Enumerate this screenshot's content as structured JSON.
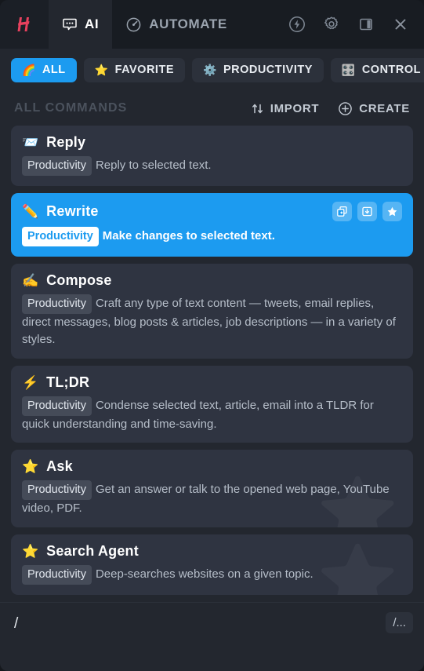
{
  "theme": {
    "page_bg": "#23272f",
    "chrome_bg": "#181c22",
    "card_bg": "#2f3441",
    "accent": "#1c9bf0",
    "logo_color": "#e8415e",
    "text_primary": "#ffffff",
    "text_muted": "#b6bec9",
    "section_title_color": "#4b525d"
  },
  "titlebar": {
    "logo_name": "app-logo",
    "tabs": [
      {
        "id": "ai",
        "label": "AI",
        "icon": "chat-bubble-icon",
        "active": true
      },
      {
        "id": "automate",
        "label": "AUTOMATE",
        "icon": "gauge-icon",
        "active": false
      }
    ],
    "icons": [
      {
        "id": "bolt",
        "name": "bolt-circle-icon"
      },
      {
        "id": "settings",
        "name": "gear-icon"
      },
      {
        "id": "panel",
        "name": "side-panel-icon"
      },
      {
        "id": "close",
        "name": "close-icon"
      }
    ]
  },
  "filters": [
    {
      "id": "all",
      "label": "ALL",
      "emoji": "🌈",
      "active": true
    },
    {
      "id": "favorite",
      "label": "FAVORITE",
      "emoji": "⭐",
      "active": false
    },
    {
      "id": "productivity",
      "label": "PRODUCTIVITY",
      "emoji": "⚙️",
      "active": false
    },
    {
      "id": "control",
      "label": "CONTROL",
      "emoji": "🎛️",
      "active": false
    }
  ],
  "section": {
    "title": "ALL COMMANDS",
    "import_label": "IMPORT",
    "create_label": "CREATE"
  },
  "commands": [
    {
      "title": "Reply",
      "emoji": "📨",
      "tag": "Productivity",
      "description": "Reply to selected text.",
      "selected": false,
      "watermark": ""
    },
    {
      "title": "Rewrite",
      "emoji": "✏️",
      "tag": "Productivity",
      "description": "Make changes to selected text.",
      "selected": true,
      "watermark": "",
      "actions": [
        {
          "id": "duplicate",
          "name": "duplicate-icon"
        },
        {
          "id": "save",
          "name": "save-icon"
        },
        {
          "id": "favorite",
          "name": "star-icon"
        }
      ]
    },
    {
      "title": "Compose",
      "emoji": "✍️",
      "tag": "Productivity",
      "description": "Craft any type of text content — tweets, email replies, direct messages, blog posts & articles, job descriptions — in a variety of styles.",
      "selected": false,
      "watermark": ""
    },
    {
      "title": "TL;DR",
      "emoji": "⚡",
      "tag": "Productivity",
      "description": "Condense selected text, article, email into a TLDR for quick understanding and time-saving.",
      "selected": false,
      "watermark": ""
    },
    {
      "title": "Ask",
      "emoji": "⭐",
      "tag": "Productivity",
      "description": "Get an answer or talk to the opened web page, YouTube video, PDF.",
      "selected": false,
      "watermark": "⭐"
    },
    {
      "title": "Search Agent",
      "emoji": "⭐",
      "tag": "Productivity",
      "description": "Deep-searches websites on a given topic.",
      "selected": false,
      "watermark": "⭐"
    }
  ],
  "composer": {
    "value": "/",
    "placeholder": "/",
    "button_label": "/..."
  }
}
